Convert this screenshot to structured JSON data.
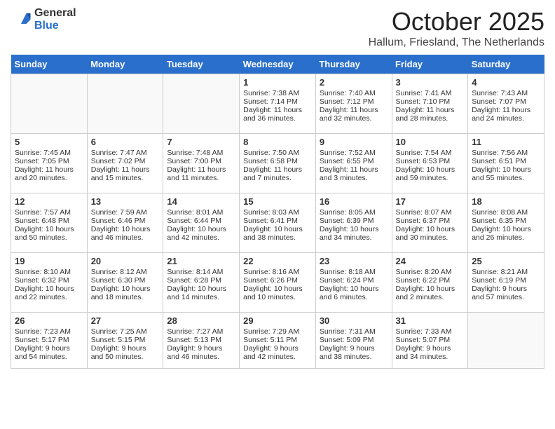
{
  "header": {
    "logo_general": "General",
    "logo_blue": "Blue",
    "title": "October 2025",
    "subtitle": "Hallum, Friesland, The Netherlands"
  },
  "weekdays": [
    "Sunday",
    "Monday",
    "Tuesday",
    "Wednesday",
    "Thursday",
    "Friday",
    "Saturday"
  ],
  "weeks": [
    [
      {
        "day": "",
        "text": ""
      },
      {
        "day": "",
        "text": ""
      },
      {
        "day": "",
        "text": ""
      },
      {
        "day": "1",
        "text": "Sunrise: 7:38 AM\nSunset: 7:14 PM\nDaylight: 11 hours and 36 minutes."
      },
      {
        "day": "2",
        "text": "Sunrise: 7:40 AM\nSunset: 7:12 PM\nDaylight: 11 hours and 32 minutes."
      },
      {
        "day": "3",
        "text": "Sunrise: 7:41 AM\nSunset: 7:10 PM\nDaylight: 11 hours and 28 minutes."
      },
      {
        "day": "4",
        "text": "Sunrise: 7:43 AM\nSunset: 7:07 PM\nDaylight: 11 hours and 24 minutes."
      }
    ],
    [
      {
        "day": "5",
        "text": "Sunrise: 7:45 AM\nSunset: 7:05 PM\nDaylight: 11 hours and 20 minutes."
      },
      {
        "day": "6",
        "text": "Sunrise: 7:47 AM\nSunset: 7:02 PM\nDaylight: 11 hours and 15 minutes."
      },
      {
        "day": "7",
        "text": "Sunrise: 7:48 AM\nSunset: 7:00 PM\nDaylight: 11 hours and 11 minutes."
      },
      {
        "day": "8",
        "text": "Sunrise: 7:50 AM\nSunset: 6:58 PM\nDaylight: 11 hours and 7 minutes."
      },
      {
        "day": "9",
        "text": "Sunrise: 7:52 AM\nSunset: 6:55 PM\nDaylight: 11 hours and 3 minutes."
      },
      {
        "day": "10",
        "text": "Sunrise: 7:54 AM\nSunset: 6:53 PM\nDaylight: 10 hours and 59 minutes."
      },
      {
        "day": "11",
        "text": "Sunrise: 7:56 AM\nSunset: 6:51 PM\nDaylight: 10 hours and 55 minutes."
      }
    ],
    [
      {
        "day": "12",
        "text": "Sunrise: 7:57 AM\nSunset: 6:48 PM\nDaylight: 10 hours and 50 minutes."
      },
      {
        "day": "13",
        "text": "Sunrise: 7:59 AM\nSunset: 6:46 PM\nDaylight: 10 hours and 46 minutes."
      },
      {
        "day": "14",
        "text": "Sunrise: 8:01 AM\nSunset: 6:44 PM\nDaylight: 10 hours and 42 minutes."
      },
      {
        "day": "15",
        "text": "Sunrise: 8:03 AM\nSunset: 6:41 PM\nDaylight: 10 hours and 38 minutes."
      },
      {
        "day": "16",
        "text": "Sunrise: 8:05 AM\nSunset: 6:39 PM\nDaylight: 10 hours and 34 minutes."
      },
      {
        "day": "17",
        "text": "Sunrise: 8:07 AM\nSunset: 6:37 PM\nDaylight: 10 hours and 30 minutes."
      },
      {
        "day": "18",
        "text": "Sunrise: 8:08 AM\nSunset: 6:35 PM\nDaylight: 10 hours and 26 minutes."
      }
    ],
    [
      {
        "day": "19",
        "text": "Sunrise: 8:10 AM\nSunset: 6:32 PM\nDaylight: 10 hours and 22 minutes."
      },
      {
        "day": "20",
        "text": "Sunrise: 8:12 AM\nSunset: 6:30 PM\nDaylight: 10 hours and 18 minutes."
      },
      {
        "day": "21",
        "text": "Sunrise: 8:14 AM\nSunset: 6:28 PM\nDaylight: 10 hours and 14 minutes."
      },
      {
        "day": "22",
        "text": "Sunrise: 8:16 AM\nSunset: 6:26 PM\nDaylight: 10 hours and 10 minutes."
      },
      {
        "day": "23",
        "text": "Sunrise: 8:18 AM\nSunset: 6:24 PM\nDaylight: 10 hours and 6 minutes."
      },
      {
        "day": "24",
        "text": "Sunrise: 8:20 AM\nSunset: 6:22 PM\nDaylight: 10 hours and 2 minutes."
      },
      {
        "day": "25",
        "text": "Sunrise: 8:21 AM\nSunset: 6:19 PM\nDaylight: 9 hours and 57 minutes."
      }
    ],
    [
      {
        "day": "26",
        "text": "Sunrise: 7:23 AM\nSunset: 5:17 PM\nDaylight: 9 hours and 54 minutes."
      },
      {
        "day": "27",
        "text": "Sunrise: 7:25 AM\nSunset: 5:15 PM\nDaylight: 9 hours and 50 minutes."
      },
      {
        "day": "28",
        "text": "Sunrise: 7:27 AM\nSunset: 5:13 PM\nDaylight: 9 hours and 46 minutes."
      },
      {
        "day": "29",
        "text": "Sunrise: 7:29 AM\nSunset: 5:11 PM\nDaylight: 9 hours and 42 minutes."
      },
      {
        "day": "30",
        "text": "Sunrise: 7:31 AM\nSunset: 5:09 PM\nDaylight: 9 hours and 38 minutes."
      },
      {
        "day": "31",
        "text": "Sunrise: 7:33 AM\nSunset: 5:07 PM\nDaylight: 9 hours and 34 minutes."
      },
      {
        "day": "",
        "text": ""
      }
    ]
  ]
}
